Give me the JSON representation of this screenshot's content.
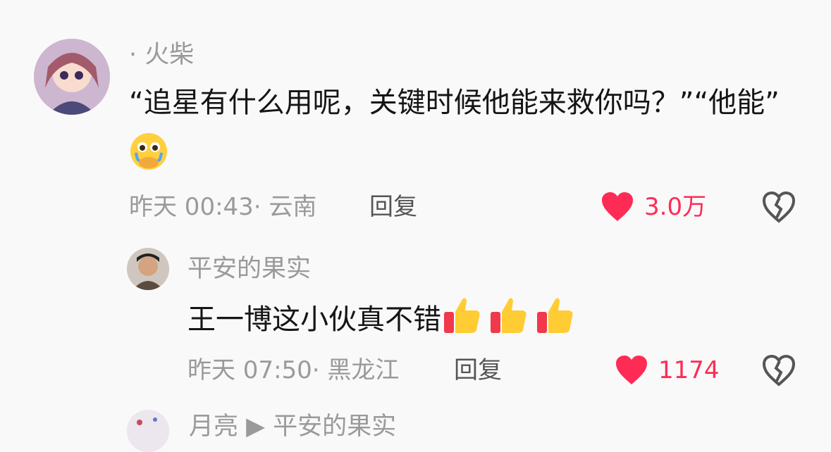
{
  "comment": {
    "author": "· 火柴",
    "text": "“追星有什么用呢，关键时候他能来救你吗？”“他能”",
    "emoji": "crying-face",
    "meta": "昨天 00:43· 云南",
    "reply_label": "回复",
    "likes": "3.0万"
  },
  "reply": {
    "author": "平安的果实",
    "text": "王一博这小伙真不错",
    "emoji_count": 3,
    "meta": "昨天 07:50· 黑龙江",
    "reply_label": "回复",
    "likes": "1174"
  },
  "third": {
    "author": "月亮 ▶ 平安的果实"
  },
  "colors": {
    "like_red": "#fe2c55",
    "meta_gray": "#9a9a9a"
  }
}
